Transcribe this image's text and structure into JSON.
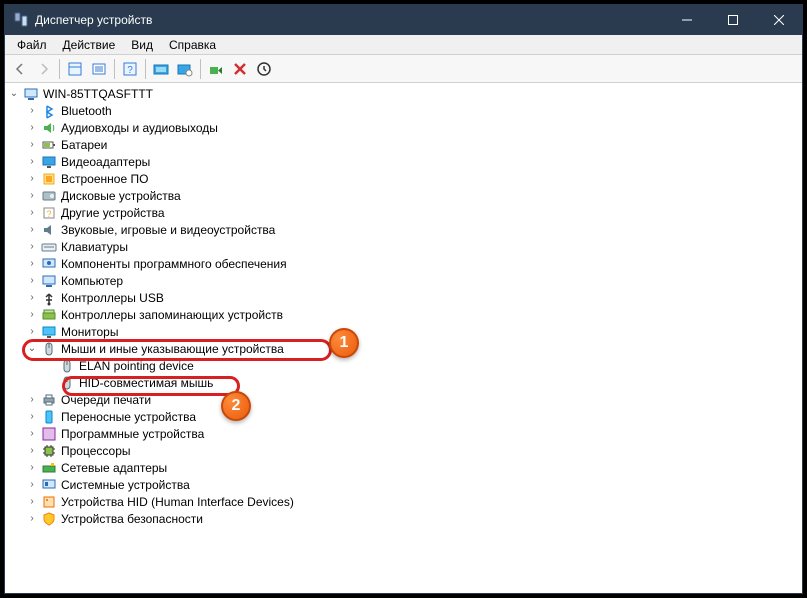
{
  "window": {
    "title": "Диспетчер устройств"
  },
  "menu": {
    "file": "Файл",
    "action": "Действие",
    "view": "Вид",
    "help": "Справка"
  },
  "tree": {
    "root": "WIN-85TTQASFTTT",
    "items": [
      {
        "label": "Bluetooth",
        "icon": "bluetooth"
      },
      {
        "label": "Аудиовходы и аудиовыходы",
        "icon": "audio"
      },
      {
        "label": "Батареи",
        "icon": "battery"
      },
      {
        "label": "Видеоадаптеры",
        "icon": "display"
      },
      {
        "label": "Встроенное ПО",
        "icon": "firmware"
      },
      {
        "label": "Дисковые устройства",
        "icon": "disk"
      },
      {
        "label": "Другие устройства",
        "icon": "other"
      },
      {
        "label": "Звуковые, игровые и видеоустройства",
        "icon": "sound"
      },
      {
        "label": "Клавиатуры",
        "icon": "keyboard"
      },
      {
        "label": "Компоненты программного обеспечения",
        "icon": "software"
      },
      {
        "label": "Компьютер",
        "icon": "computer"
      },
      {
        "label": "Контроллеры USB",
        "icon": "usb"
      },
      {
        "label": "Контроллеры запоминающих устройств",
        "icon": "storage"
      },
      {
        "label": "Мониторы",
        "icon": "monitor"
      },
      {
        "label": "Мыши и иные указывающие устройства",
        "icon": "mouse",
        "expanded": true,
        "children": [
          {
            "label": "ELAN pointing device",
            "icon": "mouse"
          },
          {
            "label": "HID-совместимая мышь",
            "icon": "mouse"
          }
        ]
      },
      {
        "label": "Очереди печати",
        "icon": "print"
      },
      {
        "label": "Переносные устройства",
        "icon": "portable"
      },
      {
        "label": "Программные устройства",
        "icon": "softdev"
      },
      {
        "label": "Процессоры",
        "icon": "cpu"
      },
      {
        "label": "Сетевые адаптеры",
        "icon": "network"
      },
      {
        "label": "Системные устройства",
        "icon": "system"
      },
      {
        "label": "Устройства HID (Human Interface Devices)",
        "icon": "hid"
      },
      {
        "label": "Устройства безопасности",
        "icon": "security"
      }
    ]
  },
  "annotations": {
    "badge1": "1",
    "badge2": "2"
  }
}
